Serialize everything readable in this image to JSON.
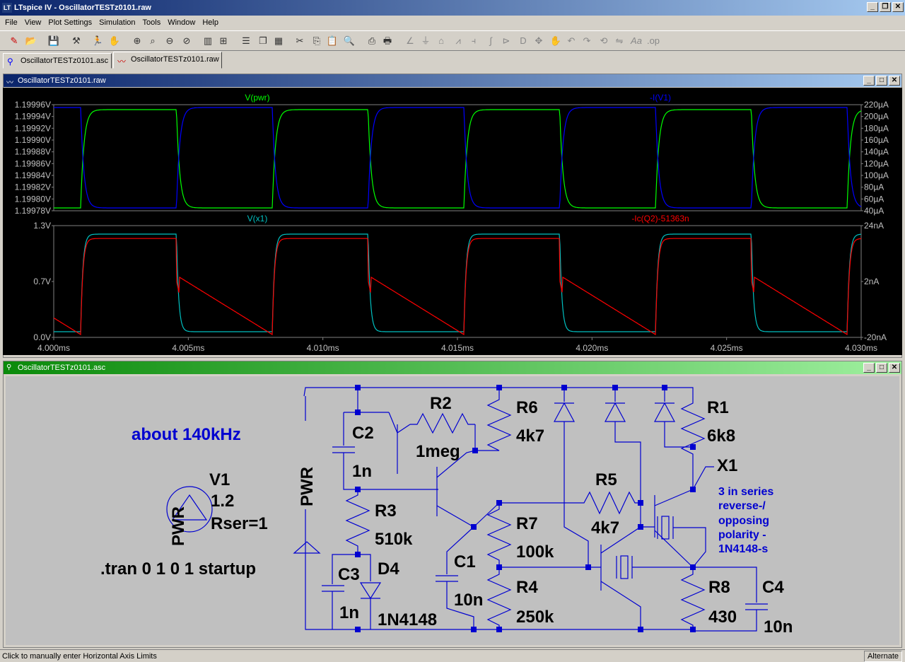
{
  "app": {
    "title": "LTspice IV - OscillatorTESTz0101.raw",
    "icon_text": "LT"
  },
  "menu": [
    "File",
    "View",
    "Plot Settings",
    "Simulation",
    "Tools",
    "Window",
    "Help"
  ],
  "tabs": [
    {
      "label": "OscillatorTESTz0101.asc"
    },
    {
      "label": "OscillatorTESTz0101.raw"
    }
  ],
  "windows": {
    "plot": {
      "title": "OscillatorTESTz0101.raw"
    },
    "schematic": {
      "title": "OscillatorTESTz0101.asc"
    }
  },
  "chart_data": [
    {
      "type": "line",
      "series": [
        {
          "name": "V(pwr)",
          "color": "#00ff00",
          "axis": "left"
        },
        {
          "name": "-I(V1)",
          "color": "#0000ff",
          "axis": "right"
        }
      ],
      "left_ticks": [
        "1.19996V",
        "1.19994V",
        "1.19992V",
        "1.19990V",
        "1.19988V",
        "1.19986V",
        "1.19984V",
        "1.19982V",
        "1.19980V",
        "1.19978V"
      ],
      "right_ticks": [
        "220µA",
        "200µA",
        "180µA",
        "160µA",
        "140µA",
        "120µA",
        "100µA",
        "80µA",
        "60µA",
        "40µA"
      ],
      "ylim_left": [
        1.19978,
        1.19996
      ],
      "ylim_right": [
        40,
        220
      ]
    },
    {
      "type": "line",
      "series": [
        {
          "name": "V(x1)",
          "color": "#00c0c0",
          "axis": "left"
        },
        {
          "name": "-Ic(Q2)-51363n",
          "color": "#ff0000",
          "axis": "right"
        }
      ],
      "left_ticks": [
        "1.3V",
        "0.7V",
        "0.0V"
      ],
      "right_ticks": [
        "24nA",
        "2nA",
        "-20nA"
      ],
      "ylim_left": [
        0.0,
        1.3
      ],
      "ylim_right": [
        -20,
        24
      ],
      "x_ticks": [
        "4.000ms",
        "4.005ms",
        "4.010ms",
        "4.015ms",
        "4.020ms",
        "4.025ms",
        "4.030ms"
      ],
      "xlim": [
        4.0,
        4.03
      ],
      "x_unit": "ms"
    }
  ],
  "schematic": {
    "note": "about 140kHz",
    "directive": ".tran 0 1 0 1 startup",
    "series_note": [
      "3 in series",
      "reverse-/",
      "opposing",
      "polarity -",
      "1N4148-s"
    ],
    "net_label": "PWR",
    "components": {
      "V1": {
        "name": "V1",
        "value": "1.2",
        "extra": "Rser=1"
      },
      "R1": {
        "name": "R1",
        "value": "6k8"
      },
      "R2": {
        "name": "R2",
        "value": "1meg"
      },
      "R3": {
        "name": "R3",
        "value": "510k"
      },
      "R4": {
        "name": "R4",
        "value": "250k"
      },
      "R5": {
        "name": "R5",
        "value": "4k7"
      },
      "R6": {
        "name": "R6",
        "value": "4k7"
      },
      "R7": {
        "name": "R7",
        "value": "100k"
      },
      "R8": {
        "name": "R8",
        "value": "430"
      },
      "C1": {
        "name": "C1",
        "value": "10n"
      },
      "C2": {
        "name": "C2",
        "value": "1n"
      },
      "C3": {
        "name": "C3",
        "value": "1n"
      },
      "C4": {
        "name": "C4",
        "value": "10n"
      },
      "D4": {
        "name": "D4",
        "value": "1N4148"
      },
      "X1": {
        "name": "X1"
      }
    }
  },
  "status": {
    "left": "Click to manually enter Horizontal Axis Limits",
    "right": "Alternate"
  }
}
